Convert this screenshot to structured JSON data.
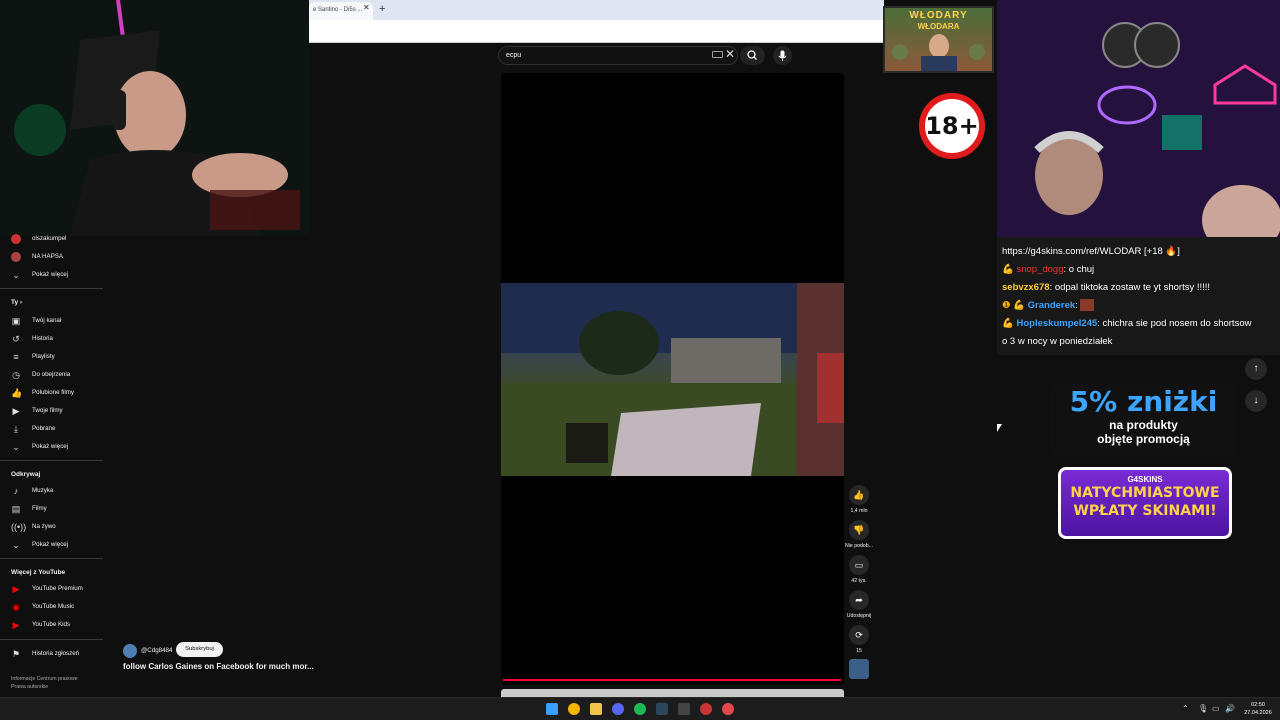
{
  "browser": {
    "tab_title": "e Santino - Di5s ...",
    "tab_close": "✕",
    "new_tab": "+"
  },
  "search": {
    "value": "ecpu",
    "clear": "✕"
  },
  "sidebar": {
    "subscriptions": [
      {
        "label": "olszakumpel"
      },
      {
        "label": "NA HAPSA"
      },
      {
        "label": "Pokaż więcej"
      }
    ],
    "you_heading": "Ty",
    "you_items": [
      {
        "label": "Twój kanał"
      },
      {
        "label": "Historia"
      },
      {
        "label": "Playlisty"
      },
      {
        "label": "Do obejrzenia"
      },
      {
        "label": "Polubione filmy"
      },
      {
        "label": "Twoje filmy"
      },
      {
        "label": "Pobrane"
      },
      {
        "label": "Pokaż więcej"
      }
    ],
    "explore_heading": "Odkrywaj",
    "explore_items": [
      {
        "label": "Muzyka"
      },
      {
        "label": "Filmy"
      },
      {
        "label": "Na żywo"
      },
      {
        "label": "Pokaż więcej"
      }
    ],
    "more_heading": "Więcej z YouTube",
    "more_items": [
      {
        "label": "YouTube Premium"
      },
      {
        "label": "YouTube Music"
      },
      {
        "label": "YouTube Kids"
      }
    ],
    "report_history": "Historia zgłoszeń",
    "footer": [
      "Informacje  Centrum prasowe",
      "Prawa autorskie"
    ]
  },
  "short": {
    "channel": "@Cdg8484",
    "subscribe": "Subskrybuj",
    "title": "follow Carlos Gaines on Facebook for much mor...",
    "progress": 1.0
  },
  "actions": {
    "likes": "1,4 mln",
    "dislike": "Nie podob...",
    "comments": "42 tys.",
    "share": "Udostępnij",
    "remix": "15"
  },
  "overlay": {
    "logo_line1": "WŁODARY",
    "logo_line2": "WŁODARA",
    "age_badge": "18+"
  },
  "chat": [
    {
      "user": "",
      "text": "https://g4skins.com/ref/WLODAR [+18 🔥]"
    },
    {
      "user": "snop_dogg",
      "text": ": o chuj",
      "color": "#e33333"
    },
    {
      "user": "sebvzx678",
      "text": ": odpal tiktoka zostaw te yt shortsy !!!!!",
      "color": "#ffcc33"
    },
    {
      "user": "Granderek",
      "text": ":",
      "color": "#3da5ff"
    },
    {
      "user": "Hopleskumpel245",
      "text": ": chichra sie pod nosem do shortsow",
      "color": "#3da5ff"
    },
    {
      "user": "",
      "text": "o 3 w nocy w poniedziałek"
    }
  ],
  "promo": {
    "discount": "5% zniżki",
    "line2": "na produkty",
    "line3": "objęte promocją",
    "brand": "G4SKINS",
    "banner_line1": "NATYCHMIASTOWE",
    "banner_line2": "WPŁATY SKINAMI!"
  },
  "taskbar": {
    "time": "02:50",
    "date": "27.04.2026"
  },
  "colors": {
    "progress": "#ff0033",
    "accent_blue": "#3da5ff",
    "badge_red": "#e01b1b"
  }
}
